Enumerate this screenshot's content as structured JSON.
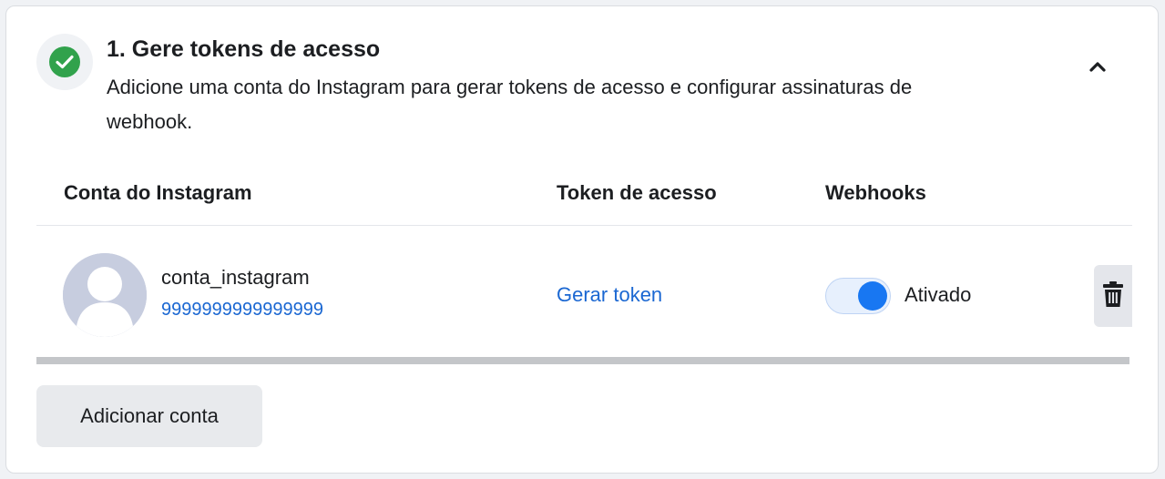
{
  "step": {
    "title": "1. Gere tokens de acesso",
    "description": "Adicione uma conta do Instagram para gerar tokens de acesso e configurar assinaturas de webhook.",
    "status": "completed",
    "collapse_icon": "chevron-up-icon"
  },
  "table": {
    "headers": {
      "account": "Conta do Instagram",
      "token": "Token de acesso",
      "webhooks": "Webhooks"
    },
    "rows": [
      {
        "username": "conta_instagram",
        "account_id": "9999999999999999",
        "token_action": "Gerar token",
        "webhooks_enabled": true,
        "webhooks_label": "Ativado",
        "delete_icon": "trash-icon"
      }
    ]
  },
  "add_account_label": "Adicionar conta",
  "colors": {
    "success": "#31a24c",
    "link": "#1a67d2",
    "toggle_on": "#1877f2",
    "avatar_placeholder": "#c7cddf"
  }
}
